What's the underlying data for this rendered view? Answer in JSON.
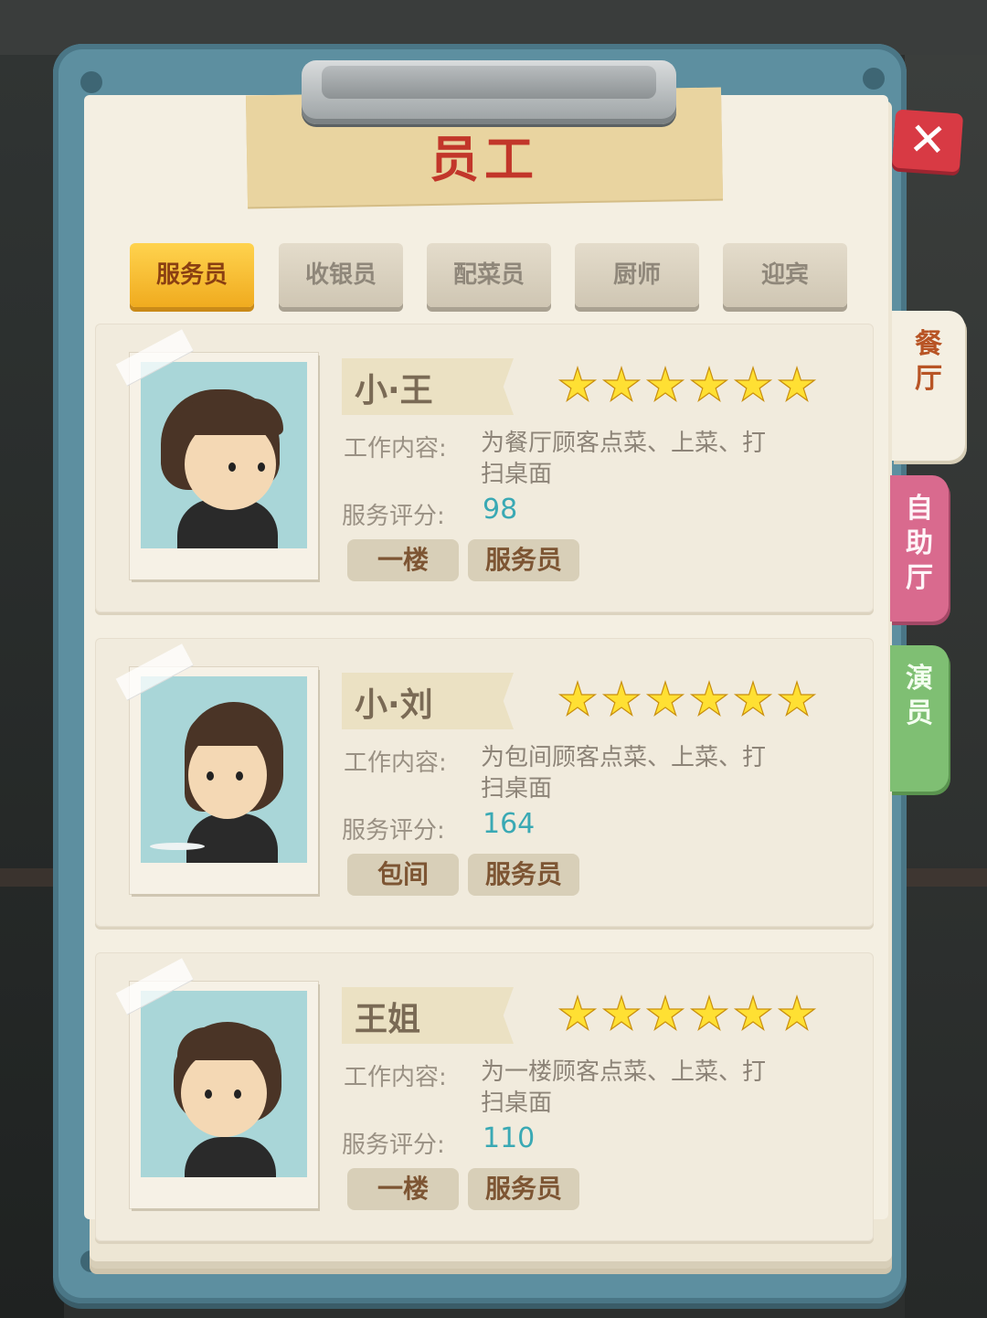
{
  "title": "员工",
  "close_icon": "close-icon",
  "tabs": [
    {
      "label": "服务员",
      "active": true
    },
    {
      "label": "收银员",
      "active": false
    },
    {
      "label": "配菜员",
      "active": false
    },
    {
      "label": "厨师",
      "active": false
    },
    {
      "label": "迎宾",
      "active": false
    }
  ],
  "side_tabs": [
    {
      "label": "餐厅",
      "active": true
    },
    {
      "label": "自助厅",
      "active": false
    },
    {
      "label": "演员",
      "active": false
    }
  ],
  "labels": {
    "work": "工作内容:",
    "score": "服务评分:"
  },
  "staff": [
    {
      "name": "小·王",
      "stars": 6,
      "work": "为餐厅顾客点菜、上菜、打扫桌面",
      "score": "98",
      "location": "一楼",
      "role": "服务员"
    },
    {
      "name": "小·刘",
      "stars": 6,
      "work": "为包间顾客点菜、上菜、打扫桌面",
      "score": "164",
      "location": "包间",
      "role": "服务员"
    },
    {
      "name": "王姐",
      "stars": 6,
      "work": "为一楼顾客点菜、上菜、打扫桌面",
      "score": "110",
      "location": "一楼",
      "role": "服务员"
    }
  ],
  "colors": {
    "board": "#5d8fa0",
    "active_tab": "#f0ab1f",
    "title": "#c2362a",
    "score": "#3aa9b4",
    "star": "#ffe033"
  }
}
